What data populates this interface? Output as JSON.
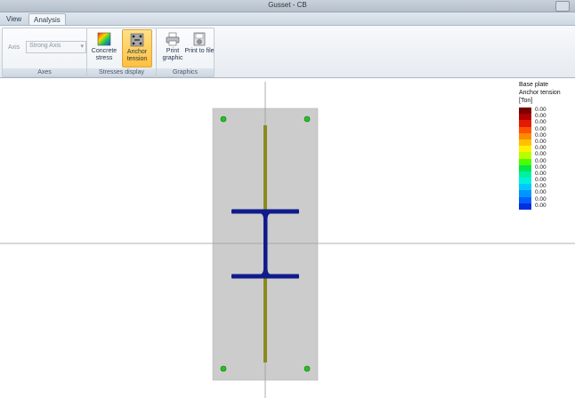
{
  "window": {
    "title": "Gusset - CB"
  },
  "tabs": [
    {
      "label": "View",
      "active": false
    },
    {
      "label": "Analysis",
      "active": true
    }
  ],
  "ribbon": {
    "axes": {
      "label": "Axes",
      "axis_field_label": "Axis",
      "axis_value": "Strong Axis"
    },
    "stresses_display": {
      "label": "Stresses display",
      "concrete": "Concrete stress",
      "anchor": "Anchor tension",
      "active": "anchor"
    },
    "graphics": {
      "label": "Graphics",
      "print_graphic": "Print graphic",
      "print_to_file": "Print to file"
    }
  },
  "legend": {
    "line1": "Base plate",
    "line2": "Anchor tension",
    "line3": "[Ton]",
    "rows": [
      {
        "value": "0.00",
        "color": "#7a0000"
      },
      {
        "value": "0.00",
        "color": "#b30000"
      },
      {
        "value": "0.00",
        "color": "#e21b00"
      },
      {
        "value": "0.00",
        "color": "#ff5200"
      },
      {
        "value": "0.00",
        "color": "#ff8a00"
      },
      {
        "value": "0.00",
        "color": "#ffc000"
      },
      {
        "value": "0.00",
        "color": "#fff000"
      },
      {
        "value": "0.00",
        "color": "#b8ff00"
      },
      {
        "value": "0.00",
        "color": "#4cff00"
      },
      {
        "value": "0.00",
        "color": "#00e84a"
      },
      {
        "value": "0.00",
        "color": "#00f0a0"
      },
      {
        "value": "0.00",
        "color": "#00f0e0"
      },
      {
        "value": "0.00",
        "color": "#00c8ff"
      },
      {
        "value": "0.00",
        "color": "#0095ff"
      },
      {
        "value": "0.00",
        "color": "#0060ff"
      },
      {
        "value": "0.00",
        "color": "#0030e0"
      }
    ]
  },
  "colors": {
    "plate": "#cccccc",
    "column": "#101c8c",
    "gusset": "#8a8a1f",
    "anchor": "#22c422",
    "crosshair": "#9a9a9a"
  }
}
